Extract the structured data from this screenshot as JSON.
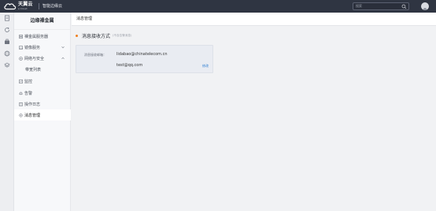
{
  "topbar": {
    "logo_cn": "天翼云",
    "logo_en": "e Cloud",
    "product_name": "智能边缘云",
    "search_placeholder": "搜索"
  },
  "sidebar": {
    "title": "边缘裸金属",
    "items": [
      {
        "label": "裸金属服务器",
        "icon": "server-icon"
      },
      {
        "label": "镜像服务",
        "icon": "image-icon",
        "expandable": true
      },
      {
        "label": "网络与安全",
        "icon": "network-icon",
        "expandable": true,
        "expanded": true
      },
      {
        "label": "带宽列表",
        "sub": true
      },
      {
        "label": "监控",
        "icon": "monitor-icon"
      },
      {
        "label": "告警",
        "icon": "alarm-icon"
      },
      {
        "label": "操作日志",
        "icon": "log-icon"
      },
      {
        "label": "消息管理",
        "icon": "message-icon",
        "active": true
      }
    ]
  },
  "main": {
    "page_title": "消息管理",
    "section_title": "消息接收方式",
    "section_hint": "(不含告警消息)",
    "card": {
      "label": "消息接收邮箱：",
      "emails": [
        "lidabao@chinatelecom.cn",
        "test@qq.com"
      ],
      "edit_label": "修改"
    }
  },
  "colors": {
    "topbar_bg": "#2f3542",
    "accent_dot": "#f07f1e",
    "link": "#2f7fd3",
    "card_bg": "#e9ecf2"
  }
}
